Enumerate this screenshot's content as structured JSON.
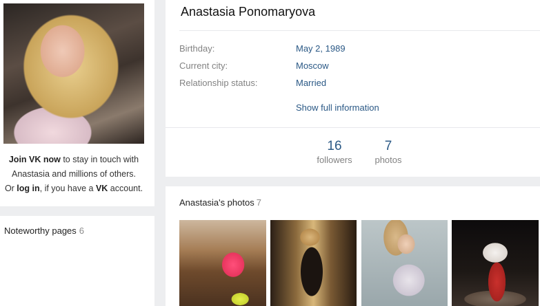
{
  "profile": {
    "name": "Anastasia Ponomaryova",
    "info": [
      {
        "label": "Birthday:",
        "value": "May 2, 1989"
      },
      {
        "label": "Current city:",
        "value": "Moscow"
      },
      {
        "label": "Relationship status:",
        "value": "Married"
      }
    ],
    "show_full": "Show full information",
    "counters": [
      {
        "value": "16",
        "label": "followers"
      },
      {
        "value": "7",
        "label": "photos"
      }
    ]
  },
  "join": {
    "join_link": "Join VK now",
    "line1_rest": " to stay in touch with",
    "line2": "Anastasia and millions of others.",
    "or": "Or ",
    "login_link": "log in",
    "mid": ", if you have a ",
    "vk": "VK",
    "end": " account."
  },
  "noteworthy": {
    "title": "Noteworthy pages",
    "count": "6"
  },
  "photos": {
    "title": "Anastasia's photos",
    "count": "7"
  },
  "colors": {
    "link": "#2a5885",
    "muted": "#828282",
    "background": "#edeef0"
  }
}
